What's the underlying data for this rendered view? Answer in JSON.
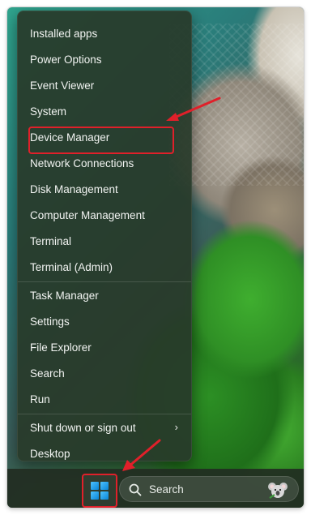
{
  "menu": {
    "groups": [
      {
        "items": [
          {
            "label": "Installed apps"
          },
          {
            "label": "Power Options"
          },
          {
            "label": "Event Viewer"
          },
          {
            "label": "System"
          },
          {
            "label": "Device Manager"
          },
          {
            "label": "Network Connections"
          },
          {
            "label": "Disk Management"
          },
          {
            "label": "Computer Management"
          },
          {
            "label": "Terminal"
          },
          {
            "label": "Terminal (Admin)"
          }
        ]
      },
      {
        "items": [
          {
            "label": "Task Manager"
          },
          {
            "label": "Settings"
          },
          {
            "label": "File Explorer"
          },
          {
            "label": "Search"
          },
          {
            "label": "Run"
          }
        ]
      },
      {
        "items": [
          {
            "label": "Shut down or sign out",
            "has_submenu": true,
            "submenu_icon": "chevron-right-icon"
          },
          {
            "label": "Desktop"
          }
        ]
      }
    ],
    "highlighted_item": "Device Manager"
  },
  "taskbar": {
    "start_button_icon": "windows-logo-icon",
    "search": {
      "label": "Search",
      "icon": "search-icon",
      "decoration_icon": "koala-icon"
    }
  },
  "annotations": {
    "color": "#e0202a",
    "arrows": 2,
    "boxes": 2
  }
}
